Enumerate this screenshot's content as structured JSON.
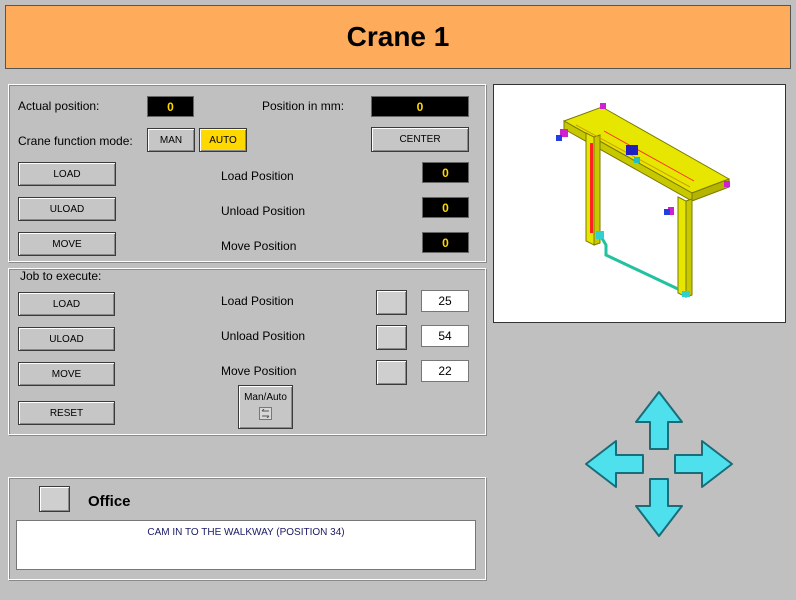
{
  "title": "Crane 1",
  "status": {
    "actual_position_label": "Actual position:",
    "actual_position_value": "0",
    "position_mm_label": "Position in mm:",
    "position_mm_value": "0",
    "function_mode_label": "Crane function mode:",
    "mode_man": "MAN",
    "mode_auto": "AUTO",
    "active_mode": "AUTO",
    "center_button": "CENTER",
    "load_button": "LOAD",
    "uload_button": "ULOAD",
    "move_button": "MOVE",
    "load_position_label": "Load Position",
    "unload_position_label": "Unload Position",
    "move_position_label": "Move Position",
    "load_position_value": "0",
    "unload_position_value": "0",
    "move_position_value": "0"
  },
  "job": {
    "header": "Job to execute:",
    "load_button": "LOAD",
    "uload_button": "ULOAD",
    "move_button": "MOVE",
    "reset_button": "RESET",
    "load_position_label": "Load Position",
    "unload_position_label": "Unload Position",
    "move_position_label": "Move Position",
    "load_position_value": "25",
    "unload_position_value": "54",
    "move_position_value": "22",
    "man_auto_label": "Man/Auto",
    "man_auto_icon": "toggle-icon"
  },
  "office": {
    "label": "Office",
    "message": "CAM IN TO THE  WALKWAY (POSITION 34)"
  },
  "colors": {
    "title_bg": "#ffab5c",
    "auto_active": "#ffd800",
    "display_text": "#ffd800",
    "arrows": "#4fe0ee",
    "crane": "#e6e600"
  },
  "icons": [
    "crane-image",
    "four-way-arrows-icon",
    "toggle-icon"
  ]
}
